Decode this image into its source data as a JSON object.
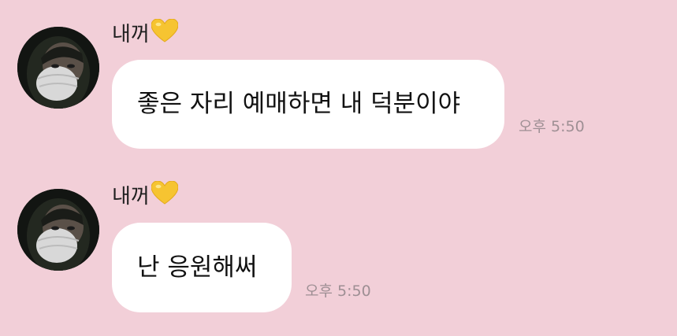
{
  "messages": [
    {
      "sender": "내꺼",
      "sender_emoji": "yellow-heart-icon",
      "text": "좋은 자리 예매하면 내 덕분이야",
      "time": "오후 5:50"
    },
    {
      "sender": "내꺼",
      "sender_emoji": "yellow-heart-icon",
      "text": "난 응원해써",
      "time": "오후 5:50"
    }
  ],
  "colors": {
    "background": "#f2cfd8",
    "bubble": "#ffffff",
    "timestamp": "#9e8f94",
    "heart": "#f6c431"
  }
}
